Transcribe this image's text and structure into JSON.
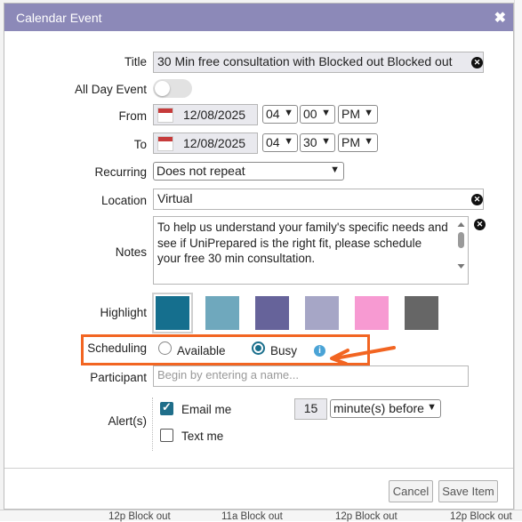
{
  "dialog": {
    "title": "Calendar Event",
    "close_icon": "close-x-icon"
  },
  "form": {
    "title_label": "Title",
    "title_value": "30 Min free consultation with Blocked out Blocked out",
    "allday_label": "All Day Event",
    "allday_on": false,
    "from_label": "From",
    "from_date": "12/08/2025",
    "from_hour": "04",
    "from_minute": "00",
    "from_ampm": "PM",
    "to_label": "To",
    "to_date": "12/08/2025",
    "to_hour": "04",
    "to_minute": "30",
    "to_ampm": "PM",
    "recurring_label": "Recurring",
    "recurring_value": "Does not repeat",
    "location_label": "Location",
    "location_value": "Virtual",
    "notes_label": "Notes",
    "notes_value": "To help us understand your family's specific needs and see if UniPrepared is the right fit, please schedule your free 30 min consultation.",
    "highlight_label": "Highlight",
    "highlight_colors": [
      "#156f8e",
      "#6fa8bd",
      "#66639a",
      "#a6a6c6",
      "#f79ad2",
      "#666666"
    ],
    "highlight_selected_index": 0,
    "scheduling_label": "Scheduling",
    "scheduling_options": [
      "Available",
      "Busy"
    ],
    "scheduling_selected": "Busy",
    "participant_label": "Participant",
    "participant_placeholder": "Begin by entering a name...",
    "alerts_label": "Alert(s)",
    "email_label": "Email me",
    "email_checked": true,
    "alert_amount": "15",
    "alert_unit": "minute(s) before",
    "text_label": "Text me",
    "text_checked": false
  },
  "footer": {
    "cancel_label": "Cancel",
    "save_label": "Save Item"
  },
  "background": {
    "items": [
      "12p Block out",
      "11a Block out",
      "12p Block out",
      "12p Block out"
    ]
  },
  "colors": {
    "titlebar": "#8c89b8",
    "annotation": "#f26522",
    "accent": "#1a6f8c"
  }
}
